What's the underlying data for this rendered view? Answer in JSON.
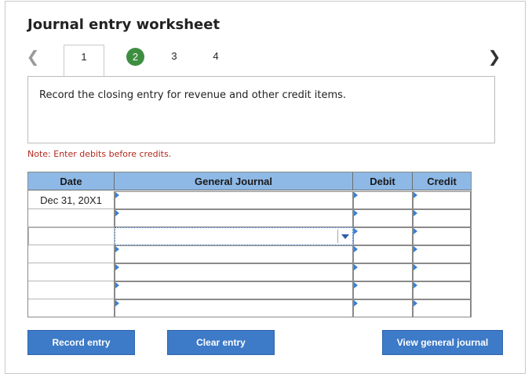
{
  "worksheet": {
    "title": "Journal entry worksheet"
  },
  "steps": {
    "prev_icon": "chevron-left-icon",
    "next_icon": "chevron-right-icon",
    "items": [
      {
        "label": "1",
        "state": "active"
      },
      {
        "label": "2",
        "state": "completed"
      },
      {
        "label": "3",
        "state": "default"
      },
      {
        "label": "4",
        "state": "default"
      }
    ]
  },
  "instruction": {
    "text": "Record the closing entry for revenue and other credit items."
  },
  "note": {
    "text": "Note: Enter debits before credits.",
    "color": "#b0291d"
  },
  "journal": {
    "headers": {
      "date": "Date",
      "general_journal": "General Journal",
      "debit": "Debit",
      "credit": "Credit"
    },
    "header_color": "#8eb9e6",
    "rows": [
      {
        "date": "Dec 31, 20X1",
        "account": "",
        "debit": "",
        "credit": ""
      },
      {
        "date": "",
        "account": "",
        "debit": "",
        "credit": ""
      },
      {
        "date": "",
        "account": "",
        "debit": "",
        "credit": ""
      },
      {
        "date": "",
        "account": "",
        "debit": "",
        "credit": ""
      },
      {
        "date": "",
        "account": "",
        "debit": "",
        "credit": ""
      },
      {
        "date": "",
        "account": "",
        "debit": "",
        "credit": ""
      },
      {
        "date": "",
        "account": "",
        "debit": "",
        "credit": ""
      }
    ]
  },
  "buttons": {
    "record_entry": "Record entry",
    "clear_entry": "Clear entry",
    "view_general_journal": "View general journal",
    "color": "#3d7ac7"
  }
}
